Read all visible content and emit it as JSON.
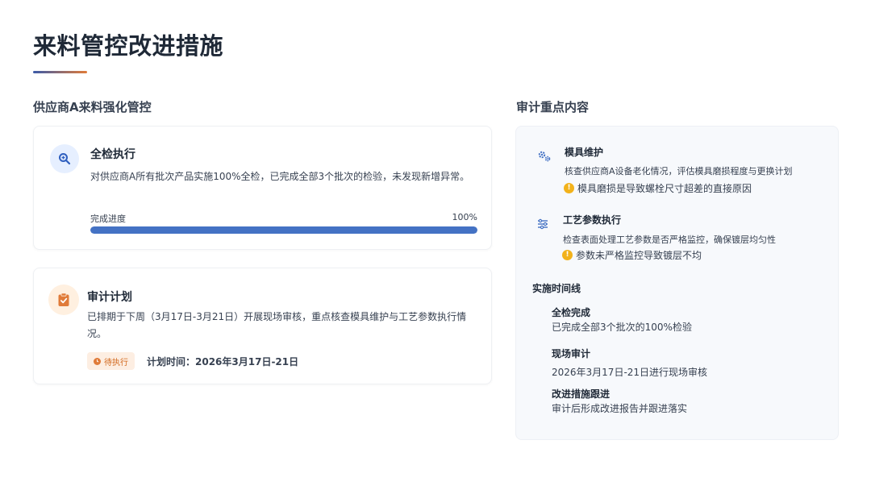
{
  "page": {
    "title": "来料管控改进措施"
  },
  "left": {
    "heading": "供应商A来料强化管控",
    "inspection": {
      "title": "全检执行",
      "description": "对供应商A所有批次产品实施100%全检，已完成全部3个批次的检验，未发现新增异常。",
      "progress_label": "完成进度",
      "progress_value": "100%",
      "progress_fraction": 1.0,
      "icon": "search-icon"
    },
    "audit": {
      "title": "审计计划",
      "description": "已排期于下周（3月17日-3月21日）开展现场审核，重点核查模具维护与工艺参数执行情况。",
      "status": "待执行",
      "plan_time": "计划时间：2026年3月17日-21日",
      "icon": "clipboard-icon"
    }
  },
  "right": {
    "heading": "审计重点内容",
    "items": [
      {
        "title": "模具维护",
        "description": "核查供应商A设备老化情况，评估模具磨损程度与更换计划",
        "warning": "模具磨损是导致螺栓尺寸超差的直接原因",
        "icon": "gears-icon"
      },
      {
        "title": "工艺参数执行",
        "description": "检查表面处理工艺参数是否严格监控，确保镀层均匀性",
        "warning": "参数未严格监控导致镀层不均",
        "icon": "sliders-icon"
      }
    ],
    "timeline": {
      "heading": "实施时间线",
      "entries": [
        {
          "title": "全检完成",
          "description": "已完成全部3个批次的100%检验"
        },
        {
          "title": "现场审计",
          "description": "2026年3月17日-21日进行现场审核"
        },
        {
          "title": "改进措施跟进",
          "description": "审计后形成改进报告并跟进落实"
        }
      ]
    }
  },
  "colors": {
    "accent_blue": "#4472c4",
    "accent_orange": "#e07b39",
    "warning_yellow": "#f2b21b",
    "badge_bg": "#fdeee2"
  }
}
